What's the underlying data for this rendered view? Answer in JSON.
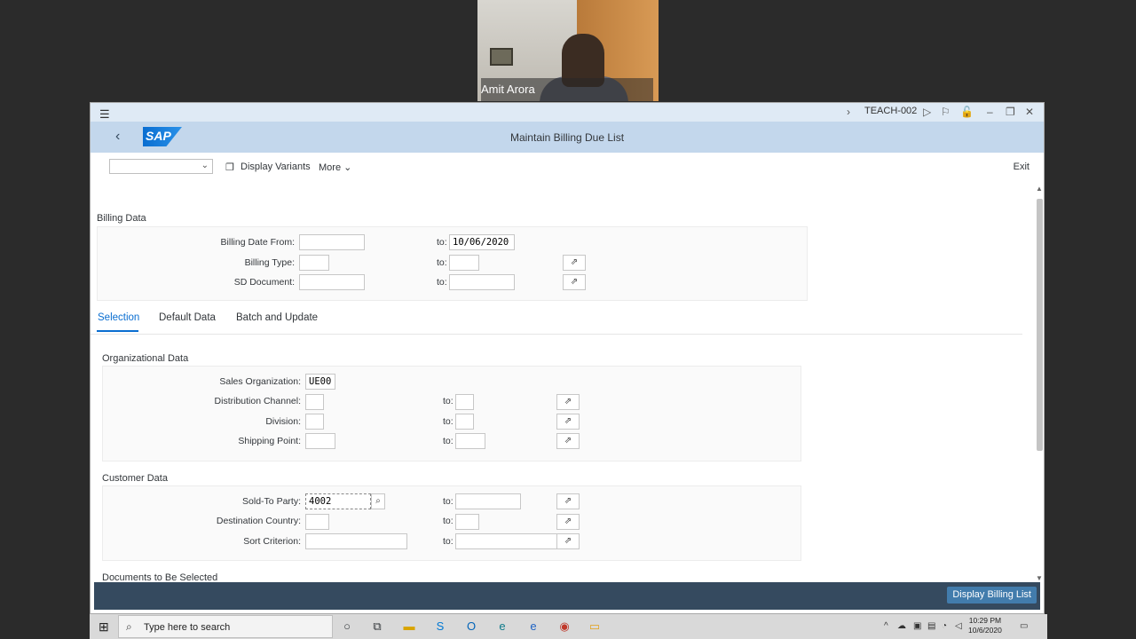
{
  "webcam": {
    "name": "Amit Arora"
  },
  "window": {
    "system": "TEACH-002",
    "app_title": "Maintain Billing Due List",
    "logo": "SAP"
  },
  "toolbar": {
    "variant_value": "",
    "display_variants": "Display Variants",
    "more": "More",
    "exit": "Exit"
  },
  "billing_data": {
    "title": "Billing Data",
    "rows": [
      {
        "label": "Billing Date From:",
        "from": "",
        "to_label": "to:",
        "to": "10/06/2020"
      },
      {
        "label": "Billing Type:",
        "from": "",
        "to_label": "to:",
        "to": ""
      },
      {
        "label": "SD Document:",
        "from": "",
        "to_label": "to:",
        "to": ""
      }
    ]
  },
  "tabs": [
    {
      "label": "Selection"
    },
    {
      "label": "Default Data"
    },
    {
      "label": "Batch and Update"
    }
  ],
  "org_data": {
    "title": "Organizational Data",
    "rows": [
      {
        "label": "Sales Organization:",
        "from": "UE00"
      },
      {
        "label": "Distribution Channel:",
        "from": "",
        "to_label": "to:",
        "to": ""
      },
      {
        "label": "Division:",
        "from": "",
        "to_label": "to:",
        "to": ""
      },
      {
        "label": "Shipping Point:",
        "from": "",
        "to_label": "to:",
        "to": ""
      }
    ]
  },
  "customer_data": {
    "title": "Customer Data",
    "rows": [
      {
        "label": "Sold-To Party:",
        "from": "4002",
        "to_label": "to:",
        "to": ""
      },
      {
        "label": "Destination Country:",
        "from": "",
        "to_label": "to:",
        "to": ""
      },
      {
        "label": "Sort Criterion:",
        "from": "",
        "to_label": "to:",
        "to": ""
      }
    ]
  },
  "documents_section": {
    "title": "Documents to Be Selected"
  },
  "footer": {
    "button": "Display Billing List"
  },
  "taskbar": {
    "search_placeholder": "Type here to search",
    "time": "10:29 PM",
    "date": "10/6/2020"
  }
}
